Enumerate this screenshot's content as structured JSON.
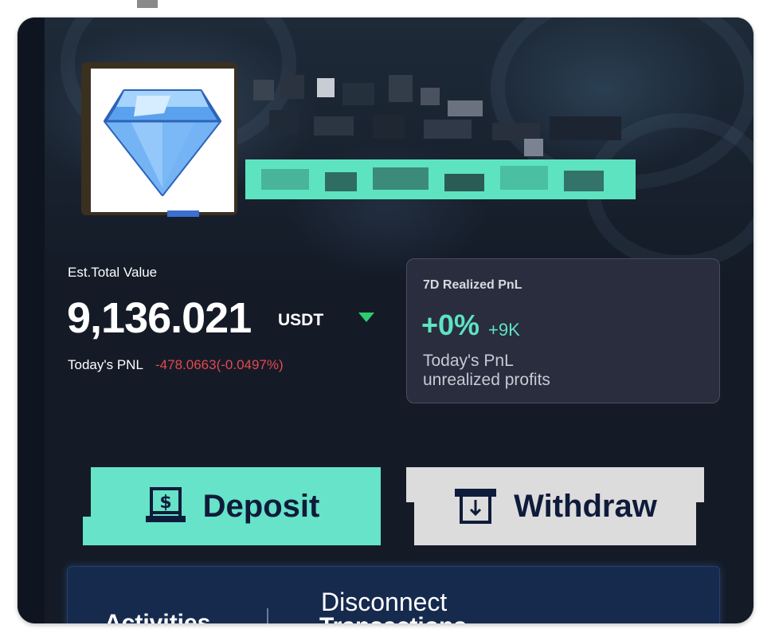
{
  "profile": {
    "avatar_icon": "diamond-icon"
  },
  "balance": {
    "label": "Est.Total Value",
    "value": "9,136.021",
    "unit": "USDT",
    "pnl_label": "Today's PNL",
    "pnl_value": "-478.0663(-0.0497%)"
  },
  "realized_card": {
    "title": "7D Realized PnL",
    "percent": "+0%",
    "amount": "+9K",
    "subtitle_line1": "Today's PnL",
    "subtitle_line2": "unrealized profits"
  },
  "actions": {
    "deposit_label": "Deposit",
    "withdraw_label": "Withdraw",
    "deposit_icon": "dollar-atm-icon",
    "withdraw_icon": "withdraw-atm-icon"
  },
  "tabs": {
    "activities": "Activities",
    "disconnect": "Disconnect",
    "transactions": "Transactions"
  },
  "colors": {
    "accent": "#66e3c8",
    "negative": "#e5484d",
    "positive": "#2ecc71",
    "background": "#141b27",
    "card": "#2a2d3e"
  }
}
